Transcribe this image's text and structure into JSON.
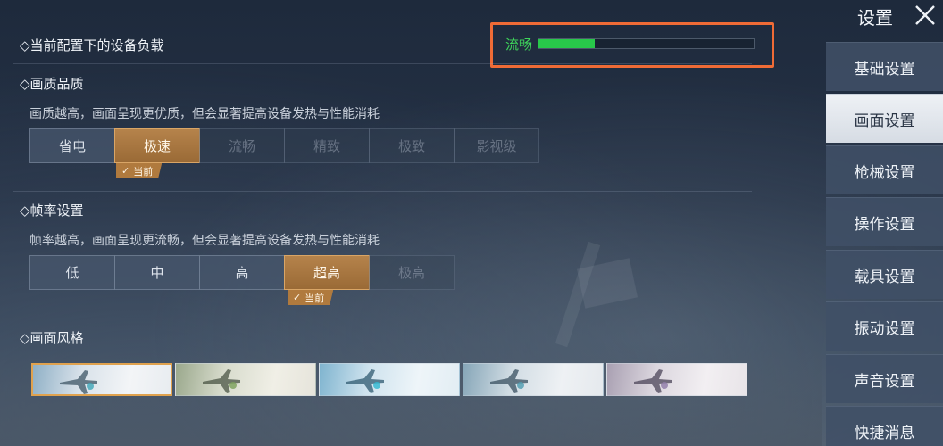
{
  "header": {
    "title": "设置"
  },
  "sidebar": {
    "items": [
      {
        "label": "基础设置",
        "active": false
      },
      {
        "label": "画面设置",
        "active": true
      },
      {
        "label": "枪械设置",
        "active": false
      },
      {
        "label": "操作设置",
        "active": false
      },
      {
        "label": "载具设置",
        "active": false
      },
      {
        "label": "振动设置",
        "active": false
      },
      {
        "label": "声音设置",
        "active": false
      },
      {
        "label": "快捷消息",
        "active": false
      }
    ]
  },
  "device_load": {
    "title": "◇当前配置下的设备负载",
    "status_label": "流畅",
    "level": 0.26,
    "color": "#28c84a",
    "highlight_color": "#ef6b36"
  },
  "quality": {
    "title": "◇画质品质",
    "description": "画质越高，画面呈现更优质，但会显著提高设备发热与性能消耗",
    "options": [
      "省电",
      "极速",
      "流畅",
      "精致",
      "极致",
      "影视级"
    ],
    "selected": "极速",
    "disabled": [
      "流畅",
      "精致",
      "极致",
      "影视级"
    ],
    "current_tag": "当前"
  },
  "framerate": {
    "title": "◇帧率设置",
    "description": "帧率越高，画面呈现更流畅，但会显著提高设备发热与性能消耗",
    "options": [
      "低",
      "中",
      "高",
      "超高",
      "极高"
    ],
    "selected": "超高",
    "disabled": [
      "极高"
    ],
    "current_tag": "当前"
  },
  "style": {
    "title": "◇画面风格",
    "thumbnail_count": 5,
    "selected_index": 0
  },
  "colors": {
    "accent": "#b07a3e",
    "selected_border": "#d9a566",
    "panel": "#46566c"
  }
}
